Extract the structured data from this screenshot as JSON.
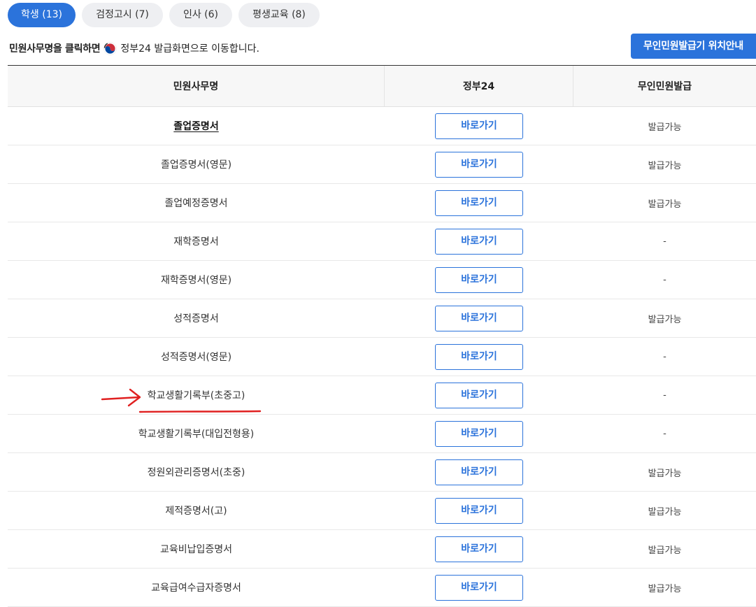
{
  "tabs": [
    {
      "label": "학생 (13)",
      "active": true
    },
    {
      "label": "검정고시 (7)",
      "active": false
    },
    {
      "label": "인사 (6)",
      "active": false
    },
    {
      "label": "평생교육 (8)",
      "active": false
    }
  ],
  "info": {
    "prefix": "민원사무명을 클릭하면",
    "suffix": "정부24 발급화면으로 이동합니다."
  },
  "locator_button": "무인민원발급기 위치안내",
  "table": {
    "headers": [
      "민원사무명",
      "정부24",
      "무인민원발급"
    ],
    "rows": [
      {
        "name": "졸업증명서",
        "button": "바로가기",
        "status": "발급가능"
      },
      {
        "name": "졸업증명서(영문)",
        "button": "바로가기",
        "status": "발급가능"
      },
      {
        "name": "졸업예정증명서",
        "button": "바로가기",
        "status": "발급가능"
      },
      {
        "name": "재학증명서",
        "button": "바로가기",
        "status": "-"
      },
      {
        "name": "재학증명서(영문)",
        "button": "바로가기",
        "status": "-"
      },
      {
        "name": "성적증명서",
        "button": "바로가기",
        "status": "발급가능"
      },
      {
        "name": "성적증명서(영문)",
        "button": "바로가기",
        "status": "-"
      },
      {
        "name": "학교생활기록부(초중고)",
        "button": "바로가기",
        "status": "-"
      },
      {
        "name": "학교생활기록부(대입전형용)",
        "button": "바로가기",
        "status": "-"
      },
      {
        "name": "정원외관리증명서(초중)",
        "button": "바로가기",
        "status": "발급가능"
      },
      {
        "name": "제적증명서(고)",
        "button": "바로가기",
        "status": "발급가능"
      },
      {
        "name": "교육비납입증명서",
        "button": "바로가기",
        "status": "발급가능"
      },
      {
        "name": "교육급여수급자증명서",
        "button": "바로가기",
        "status": "발급가능"
      }
    ]
  },
  "colors": {
    "accent": "#2b73db",
    "tab_inactive": "#eeeff2",
    "annotation": "#e02020"
  },
  "icons": {
    "gov_logo": "taegeuk-logo-icon",
    "annotation_arrow": "red-arrow-icon"
  }
}
